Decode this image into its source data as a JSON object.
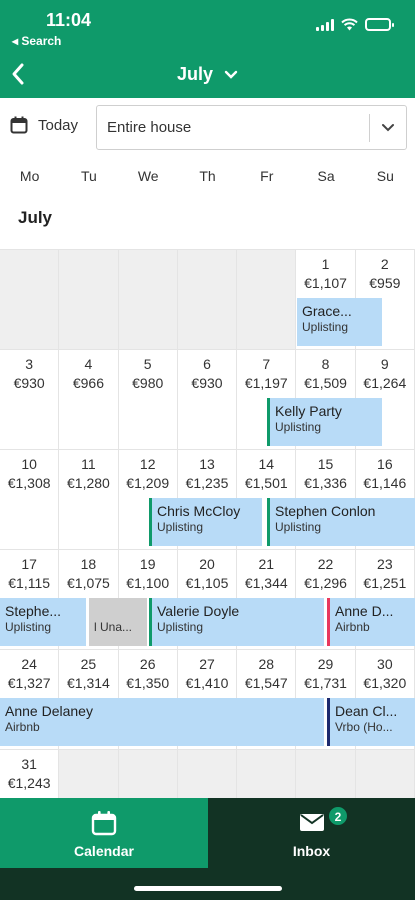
{
  "status": {
    "time": "11:04",
    "back_app": "◂ Search"
  },
  "header": {
    "title": "July"
  },
  "toolbar": {
    "today_label": "Today",
    "property_select": "Entire house"
  },
  "weekdays": [
    "Mo",
    "Tu",
    "We",
    "Th",
    "Fr",
    "Sa",
    "Su"
  ],
  "month_label": "July",
  "days": {
    "d1": {
      "day": "1",
      "price": "€1,107"
    },
    "d2": {
      "day": "2",
      "price": "€959"
    },
    "d3": {
      "day": "3",
      "price": "€930"
    },
    "d4": {
      "day": "4",
      "price": "€966"
    },
    "d5": {
      "day": "5",
      "price": "€980"
    },
    "d6": {
      "day": "6",
      "price": "€930"
    },
    "d7": {
      "day": "7",
      "price": "€1,197"
    },
    "d8": {
      "day": "8",
      "price": "€1,509"
    },
    "d9": {
      "day": "9",
      "price": "€1,264"
    },
    "d10": {
      "day": "10",
      "price": "€1,308"
    },
    "d11": {
      "day": "11",
      "price": "€1,280"
    },
    "d12": {
      "day": "12",
      "price": "€1,209"
    },
    "d13": {
      "day": "13",
      "price": "€1,235"
    },
    "d14": {
      "day": "14",
      "price": "€1,501"
    },
    "d15": {
      "day": "15",
      "price": "€1,336"
    },
    "d16": {
      "day": "16",
      "price": "€1,146"
    },
    "d17": {
      "day": "17",
      "price": "€1,115"
    },
    "d18": {
      "day": "18",
      "price": "€1,075"
    },
    "d19": {
      "day": "19",
      "price": "€1,100"
    },
    "d20": {
      "day": "20",
      "price": "€1,105"
    },
    "d21": {
      "day": "21",
      "price": "€1,344"
    },
    "d22": {
      "day": "22",
      "price": "€1,296"
    },
    "d23": {
      "day": "23",
      "price": "€1,251"
    },
    "d24": {
      "day": "24",
      "price": "€1,327"
    },
    "d25": {
      "day": "25",
      "price": "€1,314"
    },
    "d26": {
      "day": "26",
      "price": "€1,350"
    },
    "d27": {
      "day": "27",
      "price": "€1,410"
    },
    "d28": {
      "day": "28",
      "price": "€1,547"
    },
    "d29": {
      "day": "29",
      "price": "€1,731"
    },
    "d30": {
      "day": "30",
      "price": "€1,320"
    },
    "d31": {
      "day": "31",
      "price": "€1,243"
    }
  },
  "bookings": {
    "grace": {
      "name": "Grace...",
      "source": "Uplisting"
    },
    "kelly": {
      "name": "Kelly Party",
      "source": "Uplisting"
    },
    "chris": {
      "name": "Chris McCloy",
      "source": "Uplisting"
    },
    "stephen": {
      "name": "Stephen Conlon",
      "source": "Uplisting"
    },
    "stephen2": {
      "name": "Stephe...",
      "source": "Uplisting"
    },
    "unavail": {
      "name": "",
      "source": "l Una..."
    },
    "valerie": {
      "name": "Valerie Doyle",
      "source": "Uplisting"
    },
    "anne1": {
      "name": "Anne D...",
      "source": "Airbnb"
    },
    "anne2": {
      "name": "Anne Delaney",
      "source": "Airbnb"
    },
    "dean": {
      "name": "Dean Cl...",
      "source": "Vrbo (Ho..."
    }
  },
  "nav": {
    "calendar": "Calendar",
    "inbox": "Inbox",
    "inbox_badge": "2"
  },
  "colors": {
    "brand": "#0f9a6a",
    "booking_bg": "#b8dbf7",
    "airbnb": "#e8385d",
    "vrbo": "#1e2a6e",
    "nav_dark": "#123324"
  }
}
